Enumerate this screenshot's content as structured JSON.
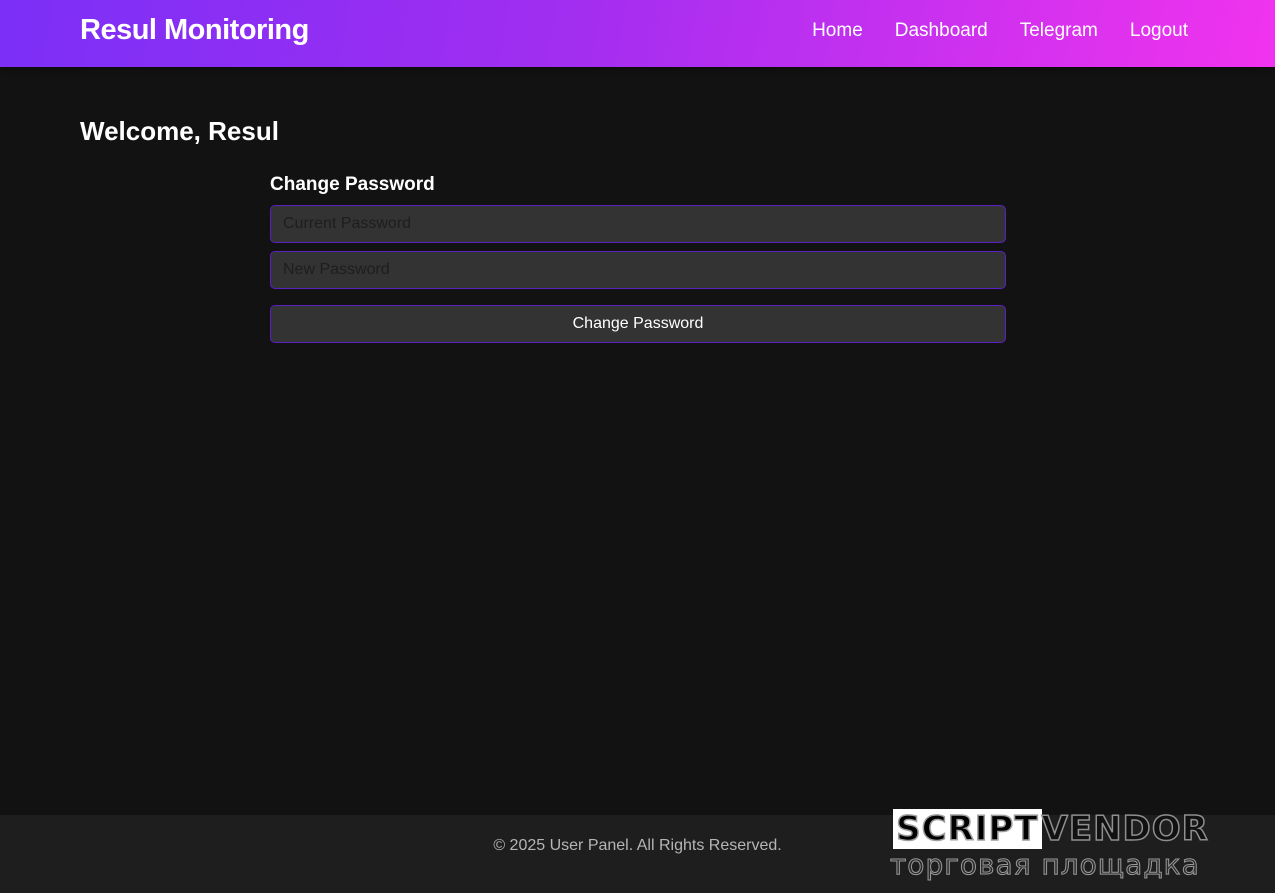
{
  "header": {
    "brand": "Resul Monitoring",
    "nav": [
      {
        "label": "Home"
      },
      {
        "label": "Dashboard"
      },
      {
        "label": "Telegram"
      },
      {
        "label": "Logout"
      }
    ]
  },
  "main": {
    "welcome": "Welcome, Resul",
    "form": {
      "title": "Change Password",
      "current_password": {
        "placeholder": "Current Password",
        "value": ""
      },
      "new_password": {
        "placeholder": "New Password",
        "value": ""
      },
      "submit_label": "Change Password"
    }
  },
  "footer": {
    "text": "© 2025 User Panel. All Rights Reserved."
  },
  "watermark": {
    "brand_part1": "SCRIPT",
    "brand_part2": "VENDOR",
    "subtitle": "торговая площадка"
  },
  "colors": {
    "header_gradient_start": "#7b2ff7",
    "header_gradient_end": "#f133ee",
    "background": "#121212",
    "field_background": "#333333",
    "field_border": "#5b1fc4",
    "footer_background": "#1e1e1e"
  }
}
